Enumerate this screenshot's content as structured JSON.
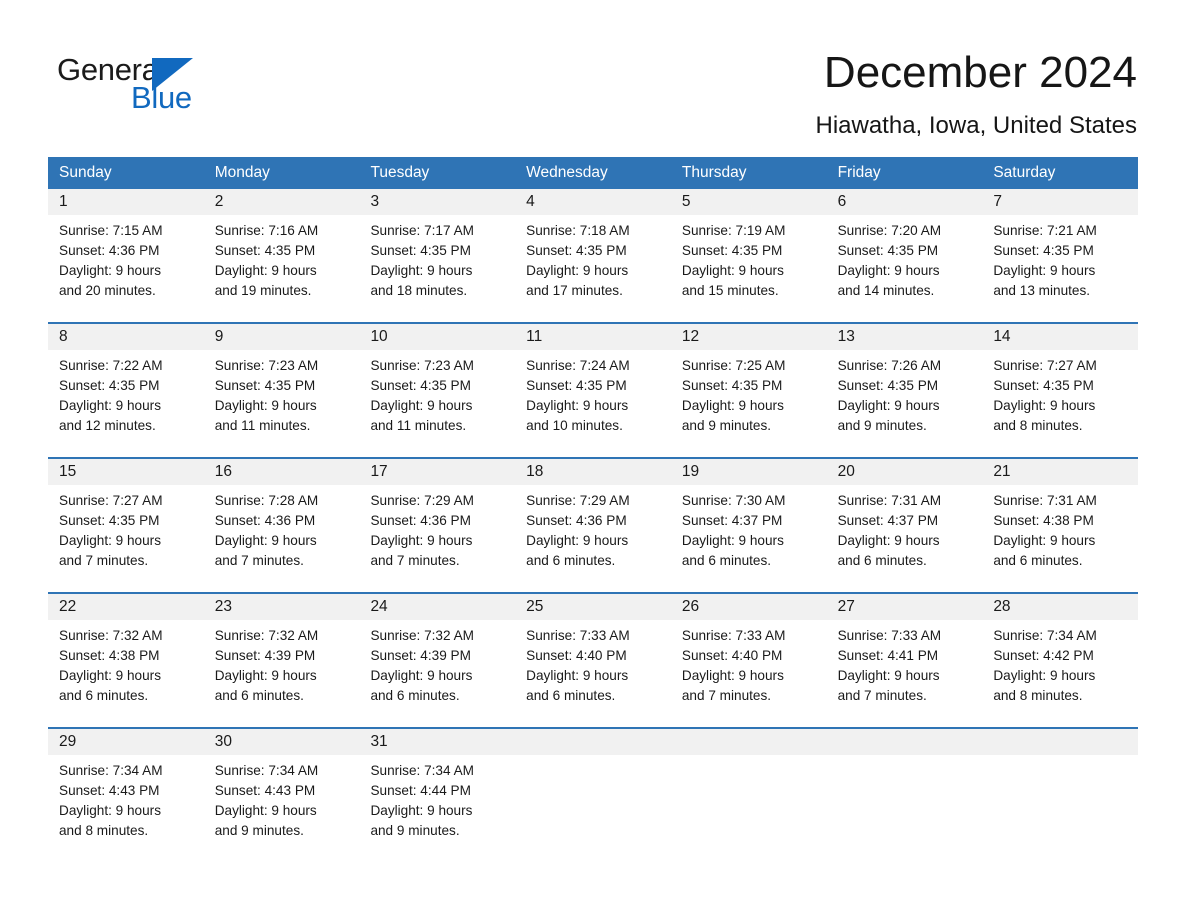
{
  "brand": {
    "name_part1": "General",
    "name_part2": "Blue",
    "accent_color": "#1169bf",
    "logo_icon": "triangle-flag-icon"
  },
  "header": {
    "month_title": "December 2024",
    "location": "Hiawatha, Iowa, United States"
  },
  "theme": {
    "header_blue": "#2f74b5",
    "date_band_gray": "#f1f1f1",
    "text_dark": "#1a1a1a"
  },
  "calendar": {
    "weekdays": [
      "Sunday",
      "Monday",
      "Tuesday",
      "Wednesday",
      "Thursday",
      "Friday",
      "Saturday"
    ],
    "weeks": [
      {
        "days": [
          {
            "num": "1",
            "sunrise": "Sunrise: 7:15 AM",
            "sunset": "Sunset: 4:36 PM",
            "daylight_1": "Daylight: 9 hours",
            "daylight_2": "and 20 minutes."
          },
          {
            "num": "2",
            "sunrise": "Sunrise: 7:16 AM",
            "sunset": "Sunset: 4:35 PM",
            "daylight_1": "Daylight: 9 hours",
            "daylight_2": "and 19 minutes."
          },
          {
            "num": "3",
            "sunrise": "Sunrise: 7:17 AM",
            "sunset": "Sunset: 4:35 PM",
            "daylight_1": "Daylight: 9 hours",
            "daylight_2": "and 18 minutes."
          },
          {
            "num": "4",
            "sunrise": "Sunrise: 7:18 AM",
            "sunset": "Sunset: 4:35 PM",
            "daylight_1": "Daylight: 9 hours",
            "daylight_2": "and 17 minutes."
          },
          {
            "num": "5",
            "sunrise": "Sunrise: 7:19 AM",
            "sunset": "Sunset: 4:35 PM",
            "daylight_1": "Daylight: 9 hours",
            "daylight_2": "and 15 minutes."
          },
          {
            "num": "6",
            "sunrise": "Sunrise: 7:20 AM",
            "sunset": "Sunset: 4:35 PM",
            "daylight_1": "Daylight: 9 hours",
            "daylight_2": "and 14 minutes."
          },
          {
            "num": "7",
            "sunrise": "Sunrise: 7:21 AM",
            "sunset": "Sunset: 4:35 PM",
            "daylight_1": "Daylight: 9 hours",
            "daylight_2": "and 13 minutes."
          }
        ]
      },
      {
        "days": [
          {
            "num": "8",
            "sunrise": "Sunrise: 7:22 AM",
            "sunset": "Sunset: 4:35 PM",
            "daylight_1": "Daylight: 9 hours",
            "daylight_2": "and 12 minutes."
          },
          {
            "num": "9",
            "sunrise": "Sunrise: 7:23 AM",
            "sunset": "Sunset: 4:35 PM",
            "daylight_1": "Daylight: 9 hours",
            "daylight_2": "and 11 minutes."
          },
          {
            "num": "10",
            "sunrise": "Sunrise: 7:23 AM",
            "sunset": "Sunset: 4:35 PM",
            "daylight_1": "Daylight: 9 hours",
            "daylight_2": "and 11 minutes."
          },
          {
            "num": "11",
            "sunrise": "Sunrise: 7:24 AM",
            "sunset": "Sunset: 4:35 PM",
            "daylight_1": "Daylight: 9 hours",
            "daylight_2": "and 10 minutes."
          },
          {
            "num": "12",
            "sunrise": "Sunrise: 7:25 AM",
            "sunset": "Sunset: 4:35 PM",
            "daylight_1": "Daylight: 9 hours",
            "daylight_2": "and 9 minutes."
          },
          {
            "num": "13",
            "sunrise": "Sunrise: 7:26 AM",
            "sunset": "Sunset: 4:35 PM",
            "daylight_1": "Daylight: 9 hours",
            "daylight_2": "and 9 minutes."
          },
          {
            "num": "14",
            "sunrise": "Sunrise: 7:27 AM",
            "sunset": "Sunset: 4:35 PM",
            "daylight_1": "Daylight: 9 hours",
            "daylight_2": "and 8 minutes."
          }
        ]
      },
      {
        "days": [
          {
            "num": "15",
            "sunrise": "Sunrise: 7:27 AM",
            "sunset": "Sunset: 4:35 PM",
            "daylight_1": "Daylight: 9 hours",
            "daylight_2": "and 7 minutes."
          },
          {
            "num": "16",
            "sunrise": "Sunrise: 7:28 AM",
            "sunset": "Sunset: 4:36 PM",
            "daylight_1": "Daylight: 9 hours",
            "daylight_2": "and 7 minutes."
          },
          {
            "num": "17",
            "sunrise": "Sunrise: 7:29 AM",
            "sunset": "Sunset: 4:36 PM",
            "daylight_1": "Daylight: 9 hours",
            "daylight_2": "and 7 minutes."
          },
          {
            "num": "18",
            "sunrise": "Sunrise: 7:29 AM",
            "sunset": "Sunset: 4:36 PM",
            "daylight_1": "Daylight: 9 hours",
            "daylight_2": "and 6 minutes."
          },
          {
            "num": "19",
            "sunrise": "Sunrise: 7:30 AM",
            "sunset": "Sunset: 4:37 PM",
            "daylight_1": "Daylight: 9 hours",
            "daylight_2": "and 6 minutes."
          },
          {
            "num": "20",
            "sunrise": "Sunrise: 7:31 AM",
            "sunset": "Sunset: 4:37 PM",
            "daylight_1": "Daylight: 9 hours",
            "daylight_2": "and 6 minutes."
          },
          {
            "num": "21",
            "sunrise": "Sunrise: 7:31 AM",
            "sunset": "Sunset: 4:38 PM",
            "daylight_1": "Daylight: 9 hours",
            "daylight_2": "and 6 minutes."
          }
        ]
      },
      {
        "days": [
          {
            "num": "22",
            "sunrise": "Sunrise: 7:32 AM",
            "sunset": "Sunset: 4:38 PM",
            "daylight_1": "Daylight: 9 hours",
            "daylight_2": "and 6 minutes."
          },
          {
            "num": "23",
            "sunrise": "Sunrise: 7:32 AM",
            "sunset": "Sunset: 4:39 PM",
            "daylight_1": "Daylight: 9 hours",
            "daylight_2": "and 6 minutes."
          },
          {
            "num": "24",
            "sunrise": "Sunrise: 7:32 AM",
            "sunset": "Sunset: 4:39 PM",
            "daylight_1": "Daylight: 9 hours",
            "daylight_2": "and 6 minutes."
          },
          {
            "num": "25",
            "sunrise": "Sunrise: 7:33 AM",
            "sunset": "Sunset: 4:40 PM",
            "daylight_1": "Daylight: 9 hours",
            "daylight_2": "and 6 minutes."
          },
          {
            "num": "26",
            "sunrise": "Sunrise: 7:33 AM",
            "sunset": "Sunset: 4:40 PM",
            "daylight_1": "Daylight: 9 hours",
            "daylight_2": "and 7 minutes."
          },
          {
            "num": "27",
            "sunrise": "Sunrise: 7:33 AM",
            "sunset": "Sunset: 4:41 PM",
            "daylight_1": "Daylight: 9 hours",
            "daylight_2": "and 7 minutes."
          },
          {
            "num": "28",
            "sunrise": "Sunrise: 7:34 AM",
            "sunset": "Sunset: 4:42 PM",
            "daylight_1": "Daylight: 9 hours",
            "daylight_2": "and 8 minutes."
          }
        ]
      },
      {
        "days": [
          {
            "num": "29",
            "sunrise": "Sunrise: 7:34 AM",
            "sunset": "Sunset: 4:43 PM",
            "daylight_1": "Daylight: 9 hours",
            "daylight_2": "and 8 minutes."
          },
          {
            "num": "30",
            "sunrise": "Sunrise: 7:34 AM",
            "sunset": "Sunset: 4:43 PM",
            "daylight_1": "Daylight: 9 hours",
            "daylight_2": "and 9 minutes."
          },
          {
            "num": "31",
            "sunrise": "Sunrise: 7:34 AM",
            "sunset": "Sunset: 4:44 PM",
            "daylight_1": "Daylight: 9 hours",
            "daylight_2": "and 9 minutes."
          },
          {
            "num": "",
            "sunrise": "",
            "sunset": "",
            "daylight_1": "",
            "daylight_2": ""
          },
          {
            "num": "",
            "sunrise": "",
            "sunset": "",
            "daylight_1": "",
            "daylight_2": ""
          },
          {
            "num": "",
            "sunrise": "",
            "sunset": "",
            "daylight_1": "",
            "daylight_2": ""
          },
          {
            "num": "",
            "sunrise": "",
            "sunset": "",
            "daylight_1": "",
            "daylight_2": ""
          }
        ]
      }
    ]
  }
}
